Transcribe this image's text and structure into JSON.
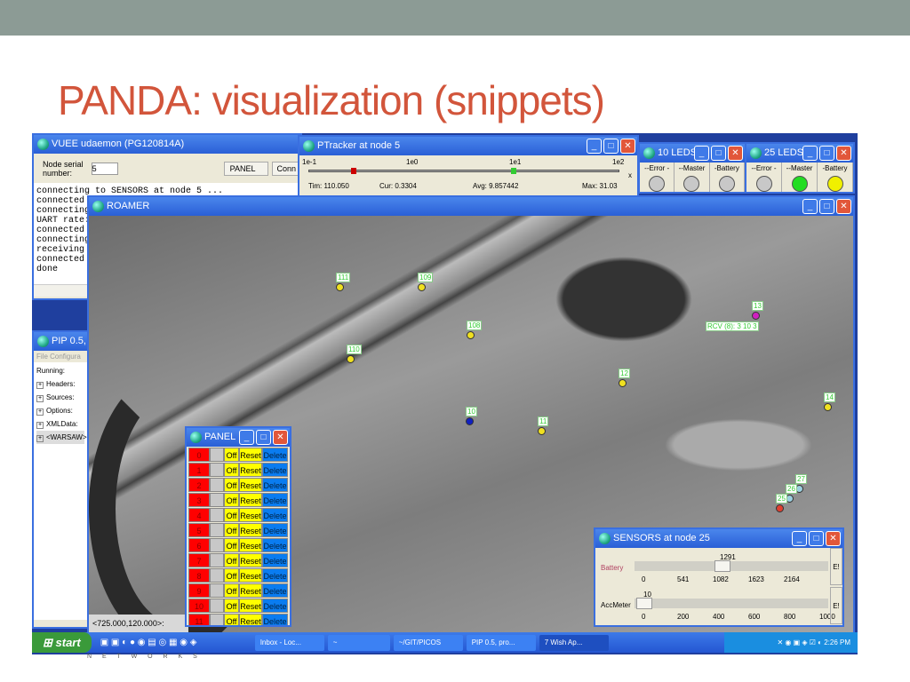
{
  "slide": {
    "title": "PANDA: visualization (snippets)",
    "footer": "N E T W O R K S"
  },
  "vuee": {
    "title": "VUEE udaemon (PG120814A)",
    "serial_label": "Node serial number:",
    "serial_value": "5",
    "panel_label": "PANEL",
    "conn_label": "Conn",
    "log": [
      "connecting to SENSORS at node 5 ...",
      "connected t",
      "connecting",
      "UART rate:",
      "connected t",
      "connecting",
      "receiving s",
      "connected t",
      "done"
    ]
  },
  "ptracker": {
    "title": "PTracker at node 5",
    "scale": [
      "1e-1",
      "1e0",
      "1e1",
      "1e2"
    ],
    "tim": "Tim: 110.050",
    "cur": "Cur: 0.3304",
    "avg": "Avg: 9.857442",
    "max": "Max: 31.03",
    "close": "x"
  },
  "leds10": {
    "title": "10 LEDS",
    "labels": [
      "--Error -",
      "--Master",
      "-Battery"
    ],
    "colors": [
      "#c8c8c8",
      "#c8c8c8",
      "#c8c8c8"
    ]
  },
  "leds25": {
    "title": "25 LEDS",
    "labels": [
      "--Error -",
      "--Master",
      "-Battery"
    ],
    "colors": [
      "#c8c8c8",
      "#22dd22",
      "#f0f000"
    ]
  },
  "pip": {
    "title": "PIP 0.5, p",
    "menu": [
      "File",
      "Configura"
    ],
    "running": "Running:",
    "tree": [
      "Headers:",
      "Sources:",
      "Options:",
      "XMLData:",
      "<WARSAW>"
    ]
  },
  "roamer": {
    "title": "ROAMER",
    "coords": "<725.000,120.000>:",
    "rcv": "RCV (8): 3 10 3",
    "nodes": [
      {
        "id": "111",
        "color": "#f0e020"
      },
      {
        "id": "109",
        "color": "#f0e020"
      },
      {
        "id": "108",
        "color": "#f0e020"
      },
      {
        "id": "110",
        "color": "#f0e020"
      },
      {
        "id": "12",
        "color": "#f0e020"
      },
      {
        "id": "10",
        "color": "#1020c0"
      },
      {
        "id": "11",
        "color": "#f0e020"
      },
      {
        "id": "13",
        "color": "#d020c0"
      },
      {
        "id": "14",
        "color": "#f0e020"
      },
      {
        "id": "27",
        "color": "#9cd0e0"
      },
      {
        "id": "26",
        "color": "#9cd0e0"
      },
      {
        "id": "25",
        "color": "#e04030"
      }
    ]
  },
  "panel": {
    "title": "PANEL",
    "off": "Off",
    "reset": "Reset",
    "delete": "Delete",
    "rows": [
      "0",
      "1",
      "2",
      "3",
      "4",
      "5",
      "6",
      "7",
      "8",
      "9",
      "10",
      "11"
    ]
  },
  "sensors": {
    "title": "SENSORS at node 25",
    "battery": {
      "label": "Battery",
      "value": "1291",
      "fraction": 0.45,
      "ticks": [
        "0",
        "541",
        "1082",
        "1623",
        "2164"
      ]
    },
    "acc": {
      "label": "AccMeter",
      "value": "10",
      "fraction": 0.01,
      "ticks": [
        "0",
        "200",
        "400",
        "600",
        "800",
        "1000"
      ]
    },
    "btn": "E!"
  },
  "taskbar": {
    "start": "start",
    "items": [
      "Inbox - Loc...",
      "~",
      "~/GIT/PICOS",
      "PIP 0.5, pro...",
      "7 Wish Ap..."
    ],
    "clock": "2:26 PM"
  }
}
